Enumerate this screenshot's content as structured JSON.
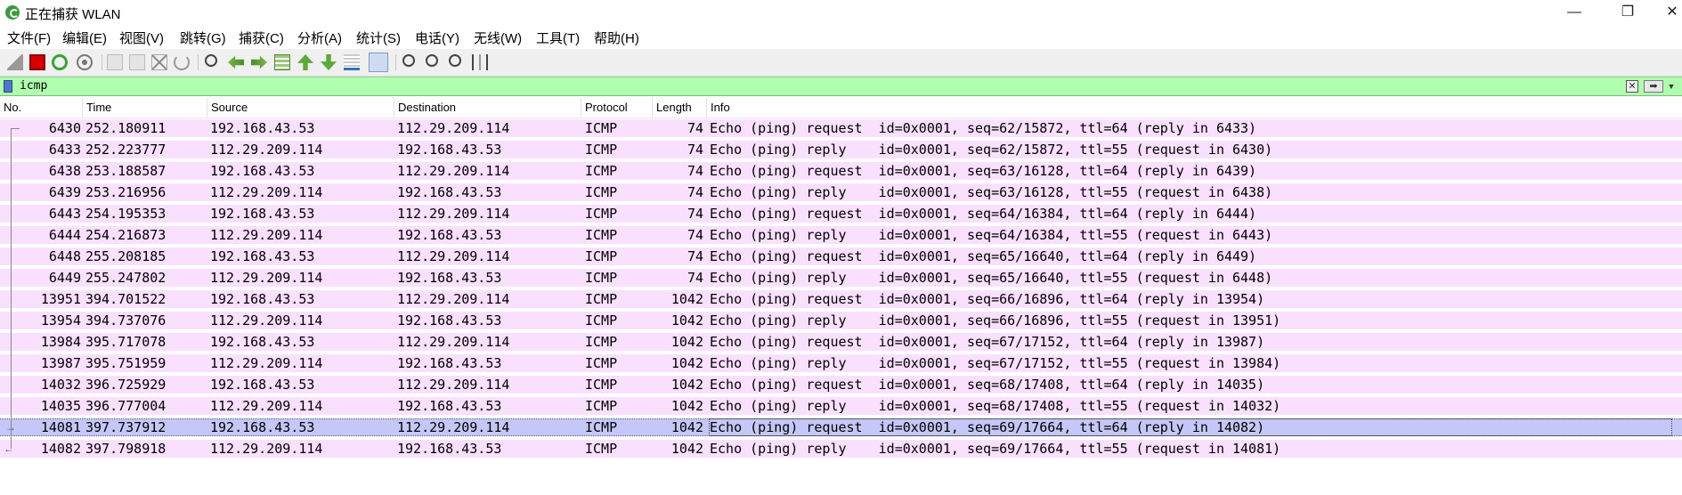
{
  "window": {
    "title": "正在捕获 WLAN",
    "minimize": "—",
    "maximize": "❐",
    "close": "✕"
  },
  "menu": [
    "文件(F)",
    "编辑(E)",
    "视图(V)",
    "跳转(G)",
    "捕获(C)",
    "分析(A)",
    "统计(S)",
    "电话(Y)",
    "无线(W)",
    "工具(T)",
    "帮助(H)"
  ],
  "toolbar": {
    "icons": [
      "shark-fin-icon",
      "stop-capture-icon",
      "restart-capture-icon",
      "capture-options-icon",
      "open-file-icon",
      "save-file-icon",
      "close-file-icon",
      "reload-file-icon",
      "find-packet-icon",
      "go-back-icon",
      "go-forward-icon",
      "go-to-packet-icon",
      "go-first-icon",
      "go-last-icon",
      "autoscroll-icon",
      "colorize-icon",
      "zoom-in-icon",
      "zoom-out-icon",
      "zoom-normal-icon",
      "resize-columns-icon"
    ]
  },
  "filter": {
    "value": "icmp",
    "colors": {
      "valid_bg": "#afffaf"
    }
  },
  "columns": [
    "No.",
    "Time",
    "Source",
    "Destination",
    "Protocol",
    "Length",
    "Info"
  ],
  "colors": {
    "icmp_row": "#fae0ff",
    "selected_row": "#c5c7f8"
  },
  "packets": [
    {
      "no": "6430",
      "time": "252.180911",
      "src": "192.168.43.53",
      "dst": "112.29.209.114",
      "proto": "ICMP",
      "len": "74",
      "info": "Echo (ping) request  id=0x0001, seq=62/15872, ttl=64 (reply in 6433)"
    },
    {
      "no": "6433",
      "time": "252.223777",
      "src": "112.29.209.114",
      "dst": "192.168.43.53",
      "proto": "ICMP",
      "len": "74",
      "info": "Echo (ping) reply    id=0x0001, seq=62/15872, ttl=55 (request in 6430)"
    },
    {
      "no": "6438",
      "time": "253.188587",
      "src": "192.168.43.53",
      "dst": "112.29.209.114",
      "proto": "ICMP",
      "len": "74",
      "info": "Echo (ping) request  id=0x0001, seq=63/16128, ttl=64 (reply in 6439)"
    },
    {
      "no": "6439",
      "time": "253.216956",
      "src": "112.29.209.114",
      "dst": "192.168.43.53",
      "proto": "ICMP",
      "len": "74",
      "info": "Echo (ping) reply    id=0x0001, seq=63/16128, ttl=55 (request in 6438)"
    },
    {
      "no": "6443",
      "time": "254.195353",
      "src": "192.168.43.53",
      "dst": "112.29.209.114",
      "proto": "ICMP",
      "len": "74",
      "info": "Echo (ping) request  id=0x0001, seq=64/16384, ttl=64 (reply in 6444)"
    },
    {
      "no": "6444",
      "time": "254.216873",
      "src": "112.29.209.114",
      "dst": "192.168.43.53",
      "proto": "ICMP",
      "len": "74",
      "info": "Echo (ping) reply    id=0x0001, seq=64/16384, ttl=55 (request in 6443)"
    },
    {
      "no": "6448",
      "time": "255.208185",
      "src": "192.168.43.53",
      "dst": "112.29.209.114",
      "proto": "ICMP",
      "len": "74",
      "info": "Echo (ping) request  id=0x0001, seq=65/16640, ttl=64 (reply in 6449)"
    },
    {
      "no": "6449",
      "time": "255.247802",
      "src": "112.29.209.114",
      "dst": "192.168.43.53",
      "proto": "ICMP",
      "len": "74",
      "info": "Echo (ping) reply    id=0x0001, seq=65/16640, ttl=55 (request in 6448)"
    },
    {
      "no": "13951",
      "time": "394.701522",
      "src": "192.168.43.53",
      "dst": "112.29.209.114",
      "proto": "ICMP",
      "len": "1042",
      "info": "Echo (ping) request  id=0x0001, seq=66/16896, ttl=64 (reply in 13954)"
    },
    {
      "no": "13954",
      "time": "394.737076",
      "src": "112.29.209.114",
      "dst": "192.168.43.53",
      "proto": "ICMP",
      "len": "1042",
      "info": "Echo (ping) reply    id=0x0001, seq=66/16896, ttl=55 (request in 13951)"
    },
    {
      "no": "13984",
      "time": "395.717078",
      "src": "192.168.43.53",
      "dst": "112.29.209.114",
      "proto": "ICMP",
      "len": "1042",
      "info": "Echo (ping) request  id=0x0001, seq=67/17152, ttl=64 (reply in 13987)"
    },
    {
      "no": "13987",
      "time": "395.751959",
      "src": "112.29.209.114",
      "dst": "192.168.43.53",
      "proto": "ICMP",
      "len": "1042",
      "info": "Echo (ping) reply    id=0x0001, seq=67/17152, ttl=55 (request in 13984)"
    },
    {
      "no": "14032",
      "time": "396.725929",
      "src": "192.168.43.53",
      "dst": "112.29.209.114",
      "proto": "ICMP",
      "len": "1042",
      "info": "Echo (ping) request  id=0x0001, seq=68/17408, ttl=64 (reply in 14035)"
    },
    {
      "no": "14035",
      "time": "396.777004",
      "src": "112.29.209.114",
      "dst": "192.168.43.53",
      "proto": "ICMP",
      "len": "1042",
      "info": "Echo (ping) reply    id=0x0001, seq=68/17408, ttl=55 (request in 14032)"
    },
    {
      "no": "14081",
      "time": "397.737912",
      "src": "192.168.43.53",
      "dst": "112.29.209.114",
      "proto": "ICMP",
      "len": "1042",
      "info": "Echo (ping) request  id=0x0001, seq=69/17664, ttl=64 (reply in 14082)",
      "selected": true
    },
    {
      "no": "14082",
      "time": "397.798918",
      "src": "112.29.209.114",
      "dst": "192.168.43.53",
      "proto": "ICMP",
      "len": "1042",
      "info": "Echo (ping) reply    id=0x0001, seq=69/17664, ttl=55 (request in 14081)"
    }
  ]
}
